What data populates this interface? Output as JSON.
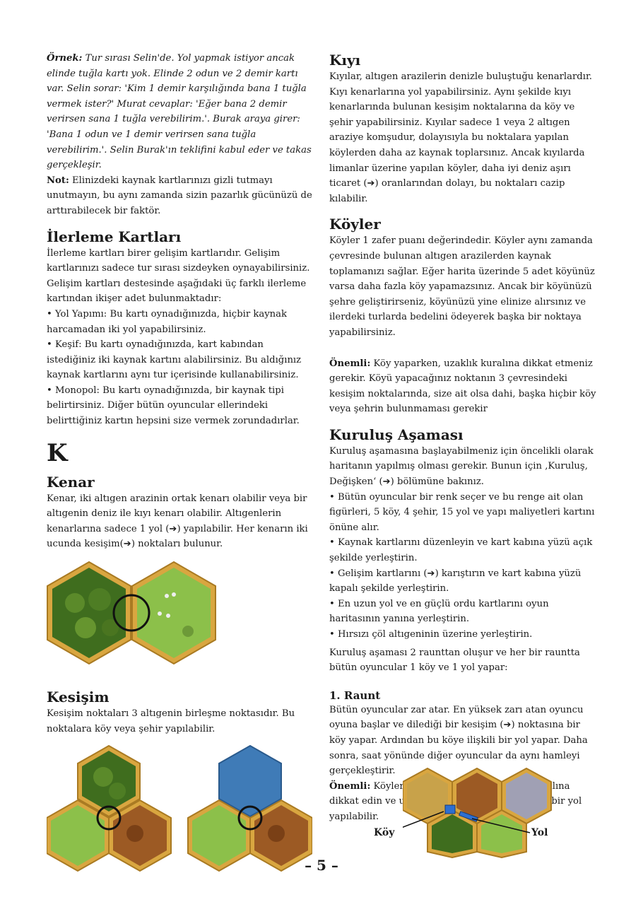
{
  "left": {
    "example_lead": "Örnek:",
    "example_text": " Tur sırası Selin'de. Yol yapmak istiyor ancak elinde tuğla kartı yok. Elinde 2 odun ve 2 demir kartı var. Selin sorar: 'Kim 1 demir karşılığında bana 1 tuğla vermek ister?' Murat cevaplar: 'Eğer bana 2 demir verirsen sana 1 tuğla verebilirim.'. Burak araya girer: 'Bana 1 odun ve 1 demir verirsen sana tuğla verebilirim.'. Selin Burak'ın teklifini kabul eder ve takas gerçekleşir.",
    "note_lead": "Not:",
    "note_text": " Elinizdeki kaynak kartlarınızı gizli tutmayı unutmayın, bu aynı zamanda sizin pazarlık gücünüzü de arttırabilecek bir faktör.",
    "progress_title": "İlerleme Kartları",
    "progress_intro": "İlerleme kartları birer gelişim kartlarıdır. Gelişim kartlarınızı sadece tur sırası sizdeyken oynayabilirsiniz. Gelişim kartları destesinde aşağıdaki üç farklı ilerleme kartından ikişer adet bulunmaktadır:",
    "bullet1": "•  Yol Yapımı: Bu kartı oynadığınızda, hiçbir kaynak harcamadan iki yol yapabilirsiniz.",
    "bullet2": "•  Keşif: Bu kartı oynadığınızda, kart kabından istediğiniz iki kaynak kartını alabilirsiniz. Bu aldığınız kaynak kartlarını aynı tur içerisinde kullanabilirsiniz.",
    "bullet3": "•  Monopol: Bu kartı oynadığınızda, bir kaynak tipi belirtirsiniz. Diğer bütün oyuncular ellerindeki belirttiğiniz kartın hepsini size vermek zorundadırlar.",
    "letter": "K",
    "edge_title": "Kenar",
    "edge_text": "Kenar, iki altıgen arazinin ortak kenarı olabilir veya bir altıgenin deniz ile kıyı kenarı olabilir. Altıgenlerin kenarlarına sadece 1 yol (➔) yapılabilir. Her kenarın iki ucunda kesişim(➔) noktaları bulunur.",
    "inter_title": "Kesişim",
    "inter_text": "Kesişim noktaları 3 altıgenin birleşme noktasıdır. Bu noktalara köy veya şehir yapılabilir."
  },
  "right": {
    "coast_title": "Kıyı",
    "coast_text": "Kıyılar, altıgen arazilerin denizle buluştuğu kenarlardır. Kıyı kenarlarına yol yapabilirsiniz. Aynı şekilde kıyı kenarlarında bulunan kesişim noktalarına da köy ve şehir yapabilirsiniz. Kıyılar sadece 1 veya 2 altıgen araziye komşudur, dolayısıyla bu noktalara yapılan köylerden daha az kaynak toplarsınız. Ancak kıyılarda limanlar üzerine yapılan köyler, daha iyi deniz aşırı ticaret (➔) oranlarından dolayı, bu noktaları cazip kılabilir.",
    "village_title": "Köyler",
    "village_text": "Köyler 1 zafer puanı değerindedir. Köyler aynı zamanda çevresinde bulunan altıgen arazilerden kaynak toplamanızı sağlar. Eğer harita üzerinde 5 adet köyünüz varsa daha fazla köy yapamazsınız. Ancak bir köyünüzü şehre geliştirirseniz, köyünüzü yine elinize alırsınız ve ilerdeki turlarda bedelini ödeyerek başka bir noktaya yapabilirsiniz.",
    "important_lead": "Önemli:",
    "important_text": " Köy yaparken, uzaklık kuralına dikkat etmeniz gerekir. Köyü yapacağınız noktanın 3 çevresindeki kesişim noktalarında, size ait olsa dahi, başka hiçbir köy veya şehrin bulunmaması gerekir",
    "setup_title": "Kuruluş Aşaması",
    "setup_intro": "Kuruluş aşamasına başlayabilmeniz için öncelikli olarak haritanın yapılmış olması gerekir. Bunun için ‚Kuruluş, Değişken‘ (➔) bölümüne bakınız.",
    "s1": "•  Bütün oyuncular bir renk seçer ve bu renge ait olan figürleri, 5 köy, 4 şehir, 15 yol ve yapı maliyetleri kartını önüne alır.",
    "s2": "•  Kaynak kartlarını düzenleyin ve kart kabına yüzü açık şekilde yerleştirin.",
    "s3": "•  Gelişim kartlarını (➔) karıştırın ve kart kabına yüzü kapalı şekilde yerleştirin.",
    "s4": "•  En uzun yol ve en güçlü ordu kartlarını oyun haritasının yanına yerleştirin.",
    "s5": "•  Hırsızı çöl altıgeninin üzerine yerleştirin.",
    "setup_outro": "Kuruluş aşaması 2 raunttan oluşur ve her bir rauntta bütün oyuncular 1 köy ve 1 yol yapar:",
    "round_title": "1. Raunt",
    "round_text": "Bütün oyuncular zar atar. En yüksek zarı atan oyuncu oyuna başlar ve dilediği bir kesişim (➔) noktasına bir köy yapar. Ardından bu köye ilişkili bir yol yapar. Daha sonra, saat yönünde diğer oyuncular da aynı hamleyi gerçekleştirir.",
    "round_imp_lead": "Önemli:",
    "round_imp_text": " Köylerinizi yerleştirirken uzaklık kuralına dikkat edin ve unutmayın ki bir kenara sadece bir yol yapılabilir.",
    "label_village": "Köy",
    "label_road": "Yol"
  },
  "page_number": "– 5 –"
}
